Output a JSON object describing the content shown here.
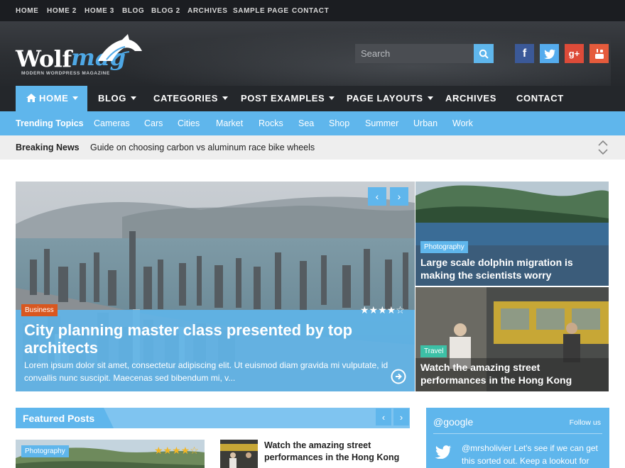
{
  "topbar": {
    "links": [
      "HOME",
      "HOME 2",
      "HOME 3",
      "BLOG",
      "BLOG 2",
      "ARCHIVES",
      "SAMPLE PAGE",
      "CONTACT"
    ]
  },
  "logo": {
    "wolf": "Wolf",
    "mag": "mag",
    "tagline": "MODERN WORDPRESS MAGAZINE"
  },
  "search": {
    "placeholder": "Search"
  },
  "social": [
    {
      "label": "f",
      "icon": "facebook-icon",
      "color": "#3b5998"
    },
    {
      "label": "t",
      "icon": "twitter-icon",
      "color": "#55acee"
    },
    {
      "label": "g+",
      "icon": "google-plus-icon",
      "color": "#dd4b39"
    },
    {
      "label": "yt",
      "icon": "youtube-icon",
      "color": "#e55b3c"
    }
  ],
  "nav": {
    "items": [
      {
        "label": "HOME",
        "dropdown": true,
        "active": true
      },
      {
        "label": "BLOG",
        "dropdown": true
      },
      {
        "label": "CATEGORIES",
        "dropdown": true
      },
      {
        "label": "POST EXAMPLES",
        "dropdown": true
      },
      {
        "label": "PAGE LAYOUTS",
        "dropdown": true
      },
      {
        "label": "ARCHIVES",
        "dropdown": false
      },
      {
        "label": "CONTACT",
        "dropdown": false
      }
    ]
  },
  "trending": {
    "label": "Trending Topics",
    "topics": [
      "Cameras",
      "Cars",
      "Cities",
      "Market",
      "Rocks",
      "Sea",
      "Shop",
      "Summer",
      "Urban",
      "Work"
    ]
  },
  "breaking": {
    "label": "Breaking News",
    "headline": "Guide on choosing carbon vs aluminum race bike wheels"
  },
  "hero": {
    "category": "Business",
    "category_color": "#d9571f",
    "rating": "★★★★☆",
    "title": "City planning master class presented by top architects",
    "excerpt": "Lorem ipsum dolor sit amet, consectetur adipiscing elit. Ut euismod diam gravida mi vulputate, id convallis nunc suscipit. Maecenas sed bibendum mi, v...",
    "prev": "‹",
    "next": "›"
  },
  "side_posts": [
    {
      "category": "Photography",
      "category_color": "#5fb6ec",
      "title": "Large scale dolphin migration is making the scientists worry"
    },
    {
      "category": "Travel",
      "category_color": "#3cc0a6",
      "title": "Watch the amazing street performances in the Hong Kong"
    }
  ],
  "featured": {
    "title": "Featured Posts",
    "prev": "‹",
    "next": "›",
    "posts": [
      {
        "category": "Photography",
        "rating": "★★★★☆"
      },
      {
        "title": "Watch the amazing street performances in the Hong Kong"
      }
    ]
  },
  "twitter_widget": {
    "title": "@google",
    "follow": "Follow us",
    "tweet": "@mrsholivier Let's see if we can get this sorted out. Keep a lookout for"
  },
  "colors": {
    "accent": "#5fb6ec",
    "dark": "#24272b",
    "topbar": "#1b1d21"
  }
}
